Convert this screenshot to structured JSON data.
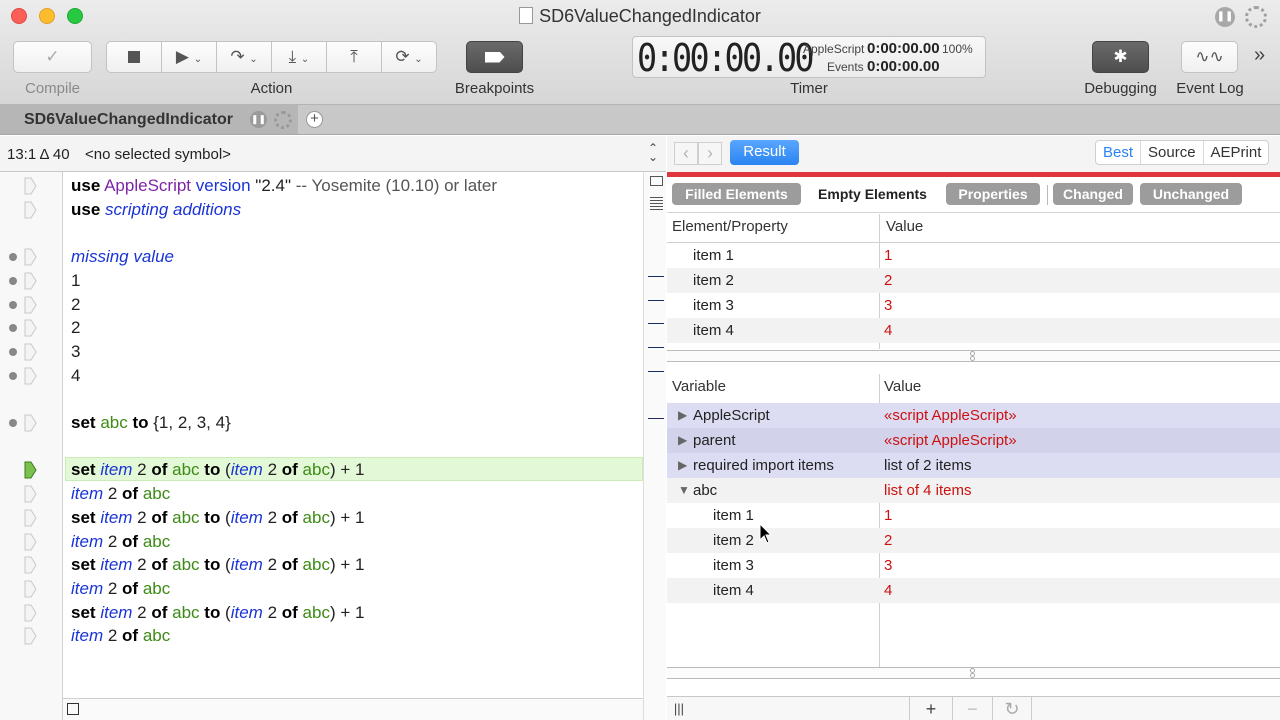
{
  "window": {
    "title": "SD6ValueChangedIndicator"
  },
  "toolbar": {
    "compile_label": "Compile",
    "action_label": "Action",
    "breakpoints_label": "Breakpoints",
    "timer_label": "Timer",
    "debugging_label": "Debugging",
    "event_log_label": "Event Log",
    "timer": {
      "main": "0:00:00.00",
      "applescript_label": "AppleScript",
      "applescript_value": "0:00:00.00",
      "percent": "100%",
      "events_label": "Events",
      "events_value": "0:00:00.00"
    }
  },
  "tabs": {
    "doc_tab": "SD6ValueChangedIndicator"
  },
  "editor": {
    "position": "13:1 Δ 40",
    "symbol": "<no selected symbol>",
    "lines": [
      [
        {
          "t": "use",
          "c": "kw"
        },
        {
          "t": " "
        },
        {
          "t": "AppleScript",
          "c": "cls"
        },
        {
          "t": " "
        },
        {
          "t": "version",
          "c": "term"
        },
        {
          "t": " \"2.4\"",
          "c": "str"
        },
        {
          "t": " -- Yosemite (10.10) or later",
          "c": "cmt"
        }
      ],
      [
        {
          "t": "use",
          "c": "kw"
        },
        {
          "t": " "
        },
        {
          "t": "scripting additions",
          "c": "it"
        }
      ],
      [],
      [
        {
          "t": "missing value",
          "c": "it"
        }
      ],
      [
        {
          "t": "1"
        }
      ],
      [
        {
          "t": "2"
        }
      ],
      [
        {
          "t": "2"
        }
      ],
      [
        {
          "t": "3"
        }
      ],
      [
        {
          "t": "4"
        }
      ],
      [],
      [
        {
          "t": "set",
          "c": "kw"
        },
        {
          "t": " "
        },
        {
          "t": "abc",
          "c": "var"
        },
        {
          "t": " "
        },
        {
          "t": "to",
          "c": "kw"
        },
        {
          "t": " {1, 2, 3, 4}"
        }
      ],
      [],
      [
        {
          "t": "set",
          "c": "kw"
        },
        {
          "t": " "
        },
        {
          "t": "item",
          "c": "it"
        },
        {
          "t": " 2 "
        },
        {
          "t": "of",
          "c": "kw"
        },
        {
          "t": " "
        },
        {
          "t": "abc",
          "c": "var"
        },
        {
          "t": " "
        },
        {
          "t": "to",
          "c": "kw"
        },
        {
          "t": " ("
        },
        {
          "t": "item",
          "c": "it"
        },
        {
          "t": " 2 "
        },
        {
          "t": "of",
          "c": "kw"
        },
        {
          "t": " "
        },
        {
          "t": "abc",
          "c": "var"
        },
        {
          "t": ") + 1"
        }
      ],
      [
        {
          "t": "item",
          "c": "it"
        },
        {
          "t": " 2 "
        },
        {
          "t": "of",
          "c": "kw"
        },
        {
          "t": " "
        },
        {
          "t": "abc",
          "c": "var"
        }
      ],
      [
        {
          "t": "set",
          "c": "kw"
        },
        {
          "t": " "
        },
        {
          "t": "item",
          "c": "it"
        },
        {
          "t": " 2 "
        },
        {
          "t": "of",
          "c": "kw"
        },
        {
          "t": " "
        },
        {
          "t": "abc",
          "c": "var"
        },
        {
          "t": " "
        },
        {
          "t": "to",
          "c": "kw"
        },
        {
          "t": " ("
        },
        {
          "t": "item",
          "c": "it"
        },
        {
          "t": " 2 "
        },
        {
          "t": "of",
          "c": "kw"
        },
        {
          "t": " "
        },
        {
          "t": "abc",
          "c": "var"
        },
        {
          "t": ") + 1"
        }
      ],
      [
        {
          "t": "item",
          "c": "it"
        },
        {
          "t": " 2 "
        },
        {
          "t": "of",
          "c": "kw"
        },
        {
          "t": " "
        },
        {
          "t": "abc",
          "c": "var"
        }
      ],
      [
        {
          "t": "set",
          "c": "kw"
        },
        {
          "t": " "
        },
        {
          "t": "item",
          "c": "it"
        },
        {
          "t": " 2 "
        },
        {
          "t": "of",
          "c": "kw"
        },
        {
          "t": " "
        },
        {
          "t": "abc",
          "c": "var"
        },
        {
          "t": " "
        },
        {
          "t": "to",
          "c": "kw"
        },
        {
          "t": " ("
        },
        {
          "t": "item",
          "c": "it"
        },
        {
          "t": " 2 "
        },
        {
          "t": "of",
          "c": "kw"
        },
        {
          "t": " "
        },
        {
          "t": "abc",
          "c": "var"
        },
        {
          "t": ") + 1"
        }
      ],
      [
        {
          "t": "item",
          "c": "it"
        },
        {
          "t": " 2 "
        },
        {
          "t": "of",
          "c": "kw"
        },
        {
          "t": " "
        },
        {
          "t": "abc",
          "c": "var"
        }
      ],
      [
        {
          "t": "set",
          "c": "kw"
        },
        {
          "t": " "
        },
        {
          "t": "item",
          "c": "it"
        },
        {
          "t": " 2 "
        },
        {
          "t": "of",
          "c": "kw"
        },
        {
          "t": " "
        },
        {
          "t": "abc",
          "c": "var"
        },
        {
          "t": " "
        },
        {
          "t": "to",
          "c": "kw"
        },
        {
          "t": " ("
        },
        {
          "t": "item",
          "c": "it"
        },
        {
          "t": " 2 "
        },
        {
          "t": "of",
          "c": "kw"
        },
        {
          "t": " "
        },
        {
          "t": "abc",
          "c": "var"
        },
        {
          "t": ") + 1"
        }
      ],
      [
        {
          "t": "item",
          "c": "it"
        },
        {
          "t": " 2 "
        },
        {
          "t": "of",
          "c": "kw"
        },
        {
          "t": " "
        },
        {
          "t": "abc",
          "c": "var"
        }
      ]
    ],
    "highlighted_line": 12,
    "breakpoint_lines": [
      3,
      4,
      5,
      6,
      7,
      8,
      10
    ]
  },
  "results": {
    "result_button": "Result",
    "formats": [
      {
        "label": "Best",
        "selected": true
      },
      {
        "label": "Source",
        "selected": false
      },
      {
        "label": "AEPrint",
        "selected": false
      }
    ],
    "filters": [
      {
        "label": "Filled Elements",
        "on": true
      },
      {
        "label": "Empty Elements",
        "on": false
      },
      {
        "label": "Properties",
        "on": true
      },
      {
        "label": "Changed",
        "on": true
      },
      {
        "label": "Unchanged",
        "on": true
      }
    ],
    "element_header": {
      "name": "Element/Property",
      "value": "Value"
    },
    "elements": [
      {
        "name": "item 1",
        "value": "1"
      },
      {
        "name": "item 2",
        "value": "2"
      },
      {
        "name": "item 3",
        "value": "3"
      },
      {
        "name": "item 4",
        "value": "4"
      }
    ],
    "variable_header": {
      "name": "Variable",
      "value": "Value"
    },
    "variables": [
      {
        "name": "AppleScript",
        "value": "«script AppleScript»",
        "expander": "closed",
        "indent": 0,
        "value_color": "red",
        "style": "hi"
      },
      {
        "name": "parent",
        "value": "«script AppleScript»",
        "expander": "closed",
        "indent": 0,
        "value_color": "red",
        "style": "hi2"
      },
      {
        "name": "required import items",
        "value": "list of 2 items",
        "expander": "closed",
        "indent": 0,
        "value_color": "black",
        "style": "hi"
      },
      {
        "name": "abc",
        "value": "list of 4 items",
        "expander": "open",
        "indent": 0,
        "value_color": "red",
        "style": "alt"
      },
      {
        "name": "item 1",
        "value": "1",
        "expander": "none",
        "indent": 1,
        "value_color": "red",
        "style": "plain"
      },
      {
        "name": "item 2",
        "value": "2",
        "expander": "none",
        "indent": 1,
        "value_color": "red",
        "style": "alt"
      },
      {
        "name": "item 3",
        "value": "3",
        "expander": "none",
        "indent": 1,
        "value_color": "red",
        "style": "plain"
      },
      {
        "name": "item 4",
        "value": "4",
        "expander": "none",
        "indent": 1,
        "value_color": "red",
        "style": "alt"
      }
    ],
    "bottom": {
      "columns": "|||",
      "add": "+",
      "remove": "−",
      "refresh": "↻"
    }
  },
  "icons": {
    "compile": "checkmark-icon",
    "stop": "stop-icon",
    "run": "play-icon",
    "step_over": "step-over-icon",
    "step_into": "step-into-icon",
    "step_out": "step-out-icon",
    "loop": "loop-icon",
    "breakpoint": "breakpoint-tag-icon",
    "debugging": "bug-icon",
    "event_log": "waveform-icon",
    "more": "chevron-right-icon"
  },
  "colors": {
    "accent": "#2a84f0",
    "error_red": "#e0363b",
    "value_red": "#cc1111",
    "highlight_green": "#e3f8d6"
  }
}
